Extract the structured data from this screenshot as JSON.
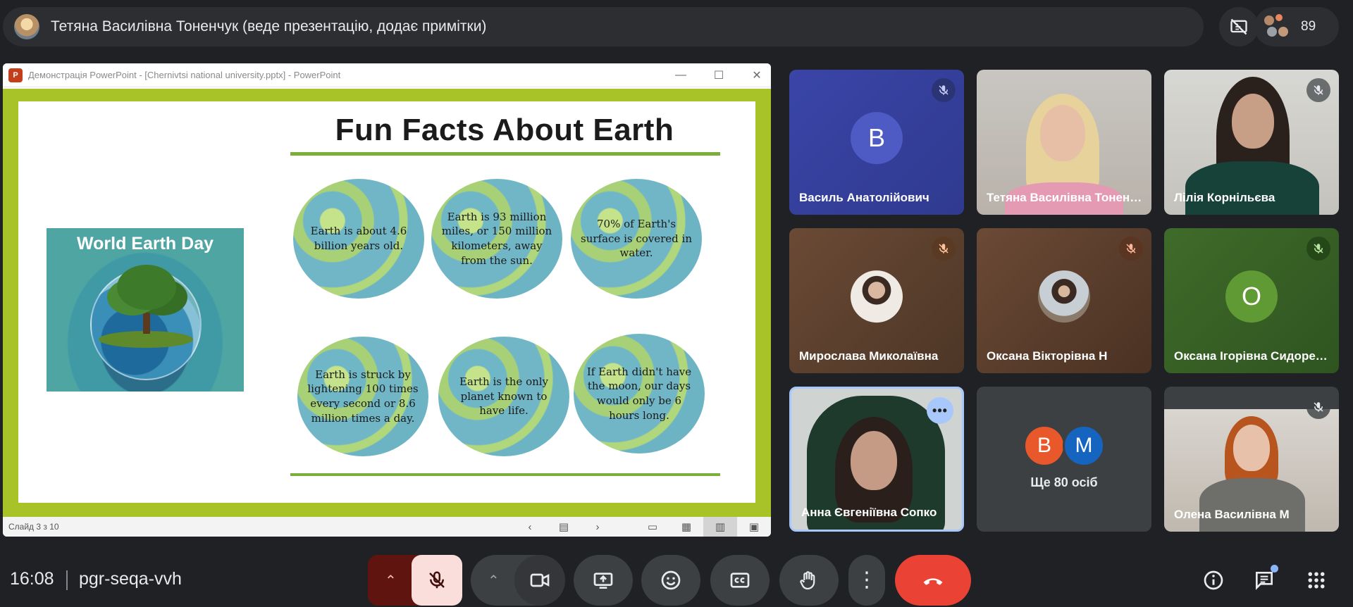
{
  "header": {
    "presenter_title": "Тетяна Василівна Тоненчук (веде презентацію, додає примітки)",
    "participant_count": "89"
  },
  "presentation": {
    "window_title": "Демонстрація PowerPoint - [Chernivtsi national university.pptx] - PowerPoint",
    "app_badge": "P",
    "slide_status": "Слайд 3 з 10",
    "slide": {
      "title": "Fun Facts About Earth",
      "image_caption": "World Earth Day",
      "facts": [
        "Earth is about 4.6 billion years old.",
        "Earth is 93 million miles, or 150 million kilometers, away from the sun.",
        "70% of Earth's surface is covered in water.",
        "Earth is struck by lightening 100 times every second or 8.6 million times a day.",
        "Earth is the only planet known to have life.",
        "If Earth didn't have the moon, our days would only be 6 hours long."
      ]
    }
  },
  "participants": [
    {
      "name": "Василь Анатолійович",
      "initial": "В",
      "muted": true
    },
    {
      "name": "Тетяна Василівна Тоненчук",
      "muted": false
    },
    {
      "name": "Лілія Корнільєва",
      "muted": true
    },
    {
      "name": "Мирослава Миколаївна",
      "muted": true
    },
    {
      "name": "Оксана Вікторівна Н",
      "muted": true
    },
    {
      "name": "Оксана Ігорівна Сидоренко",
      "initial": "О",
      "muted": true
    },
    {
      "name": "Анна Євгеніївна Сопко",
      "muted": false
    },
    {
      "name": "Олена Василівна М",
      "muted": true
    }
  ],
  "more_tile": {
    "avatar_1": "В",
    "avatar_2": "M",
    "label": "Ще 80 осіб"
  },
  "meeting": {
    "time": "16:08",
    "code": "pgr-seqa-vvh"
  },
  "colors": {
    "background": "#202124",
    "end_call": "#ea4335",
    "muted_mic_bg": "#f9dedc",
    "chevron_bg": "#601410",
    "slide_border": "#a7c328",
    "active_tile_border": "#a8c7fa"
  }
}
